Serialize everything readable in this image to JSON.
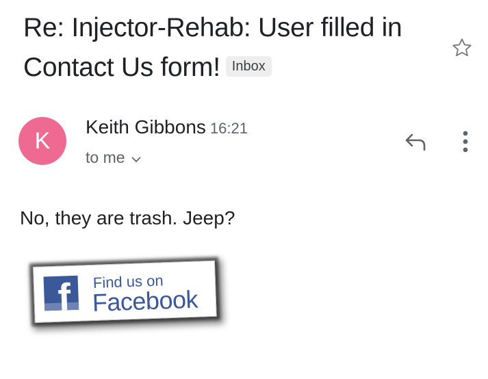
{
  "email": {
    "subject": "Re: Injector-Rehab: User filled in Contact Us form!",
    "label": "Inbox"
  },
  "icons": {
    "star": "star-outline-icon",
    "reply": "reply-icon",
    "more": "more-vert-icon",
    "chevron": "chevron-down-icon"
  },
  "sender": {
    "avatar_initial": "K",
    "avatar_color": "#ee6a92",
    "name": "Keith Gibbons",
    "time": "16:21",
    "recipient": "to me"
  },
  "message": {
    "body": "No, they are trash. Jeep?"
  },
  "facebook_badge": {
    "find_text": "Find us on",
    "brand_text": "Facebook",
    "brand_color": "#3b5998"
  }
}
